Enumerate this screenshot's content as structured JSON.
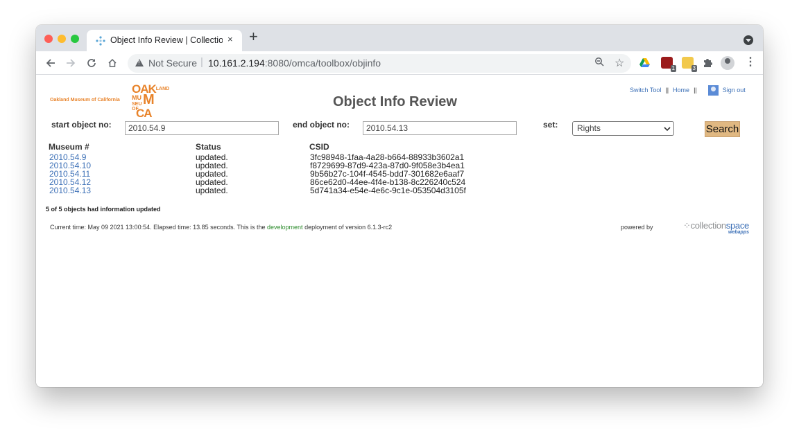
{
  "browser": {
    "tab_title": "Object Info Review | Collection",
    "tab_close": "×",
    "new_tab": "+",
    "not_secure": "Not Secure",
    "url_host": "10.161.2.194",
    "url_rest": ":8080/omca/toolbox/objinfo",
    "ext_badges": [
      "1",
      "3"
    ]
  },
  "header": {
    "org_name": "Oakland Museum of California",
    "logo_lines": [
      "OAK",
      "LAND",
      "MU",
      "M",
      "SEU",
      "OF",
      "CA"
    ],
    "page_title": "Object Info Review",
    "switch_tool": "Switch Tool",
    "home": "Home",
    "separator": "||",
    "sign_out": "Sign out"
  },
  "form": {
    "start_label": "start object no:",
    "start_value": "2010.54.9",
    "end_label": "end object no:",
    "end_value": "2010.54.13",
    "set_label": "set:",
    "set_value": "Rights",
    "search_label": "Search"
  },
  "results": {
    "columns": [
      "Museum #",
      "Status",
      "CSID"
    ],
    "rows": [
      {
        "museum": "2010.54.9",
        "status": "updated.",
        "csid": "3fc98948-1faa-4a28-b664-88933b3602a1"
      },
      {
        "museum": "2010.54.10",
        "status": "updated.",
        "csid": "f8729699-87d9-423a-87d0-9f058e3b4ea1"
      },
      {
        "museum": "2010.54.11",
        "status": "updated.",
        "csid": "9b56b27c-104f-4545-bdd7-301682e6aaf7"
      },
      {
        "museum": "2010.54.12",
        "status": "updated.",
        "csid": "86ce62d0-44ee-4f4e-b138-8c226240c524"
      },
      {
        "museum": "2010.54.13",
        "status": "updated.",
        "csid": "5d741a34-e54e-4e6c-9c1e-053504d3105f"
      }
    ]
  },
  "summary": "5 of 5 objects had information updated",
  "footer": {
    "text_before": "Current time: May 09 2021 13:00:54. Elapsed time: 13.85 seconds. This is the ",
    "dev_link": "development",
    "text_after": " deployment of version 6.1.3-rc2",
    "powered_by": "powered by",
    "cs_prefix": "collection",
    "cs_suffix": "space",
    "cs_sub": "webapps"
  },
  "colors": {
    "museum_orange": "#e8832a",
    "link_blue": "#3b6fb6",
    "search_button": "#e0b882",
    "dev_green": "#2a8a2a"
  }
}
